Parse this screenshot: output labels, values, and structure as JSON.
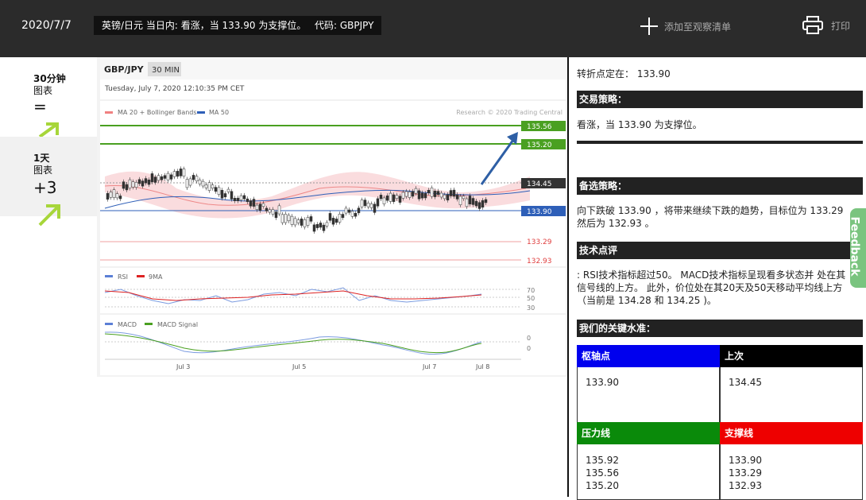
{
  "header": {
    "date": "2020/7/7",
    "headline": "英镑/日元 当日内: 看涨，当 133.90 为支撑位。",
    "code": "代码: GBPJPY",
    "watchlist_label": "添加至观察清单",
    "print_label": "打印"
  },
  "sidebar": {
    "items": [
      {
        "title": "30分钟",
        "subtitle": "图表",
        "symbol": "="
      },
      {
        "title": "1天",
        "subtitle": "图表",
        "symbol": "+3"
      }
    ]
  },
  "chart": {
    "symbol": "GBP/JPY",
    "interval": "30 MIN",
    "timestamp": "Tuesday, July 7, 2020 12:10:35 PM CET",
    "legend_ma": "MA 20 + Bollinger Bands",
    "legend_ma50": "MA 50",
    "credit": "Research © 2020 Trading Central",
    "rsi_label": "RSI",
    "rsi_ma_label": "9MA",
    "macd_label": "MACD",
    "macd_signal_label": "MACD Signal",
    "x_ticks": [
      "Jul 3",
      "Jul 5",
      "Jul 7",
      "Jul 8"
    ],
    "price_levels": [
      {
        "value": "135.56",
        "color": "#4aa021",
        "kind": "resistance"
      },
      {
        "value": "135.20",
        "color": "#4aa021",
        "kind": "resistance"
      },
      {
        "value": "134.45",
        "color": "#333333",
        "kind": "current"
      },
      {
        "value": "133.90",
        "color": "#2e5fb8",
        "kind": "pivot"
      },
      {
        "value": "133.29",
        "color": "#e04040",
        "kind": "support"
      },
      {
        "value": "132.93",
        "color": "#e04040",
        "kind": "support"
      }
    ],
    "rsi_ticks": [
      "70",
      "50",
      "30"
    ],
    "macd_ticks": [
      "0",
      "0"
    ]
  },
  "right": {
    "pivot_line": "转折点定在： 133.90",
    "strategy_title": "交易策略：",
    "strategy_text": "看涨，当 133.90 为支撑位。",
    "alt_title": "备选策略：",
    "alt_text": "向下跌破 133.90 ，将带来继续下跌的趋势，目标位为 133.29 然后为 132.93 。",
    "tech_title": "技术点评",
    "tech_text": ": RSI技术指标超过50。 MACD技术指标呈现看多状态并 处在其信号线的上方。 此外，价位处在其20天及50天移动平均线上方（当前是 134.28 和 134.25 )。",
    "levels_title": "我们的关键水准：",
    "table": {
      "pivot_header": "枢轴点",
      "last_header": "上次",
      "pivot_value": "133.90",
      "last_value": "134.45",
      "resistance_header": "压力线",
      "support_header": "支撑线",
      "resistance_values": [
        "135.92",
        "135.56",
        "135.20"
      ],
      "support_values": [
        "133.90",
        "133.29",
        "132.93"
      ]
    }
  },
  "feedback_label": "Feedback",
  "colors": {
    "pivot_header": "#0000ee",
    "last_header": "#000000",
    "resistance_header": "#0a8a0a",
    "support_header": "#ee0000",
    "accent_arrow": "#a7d63a"
  }
}
